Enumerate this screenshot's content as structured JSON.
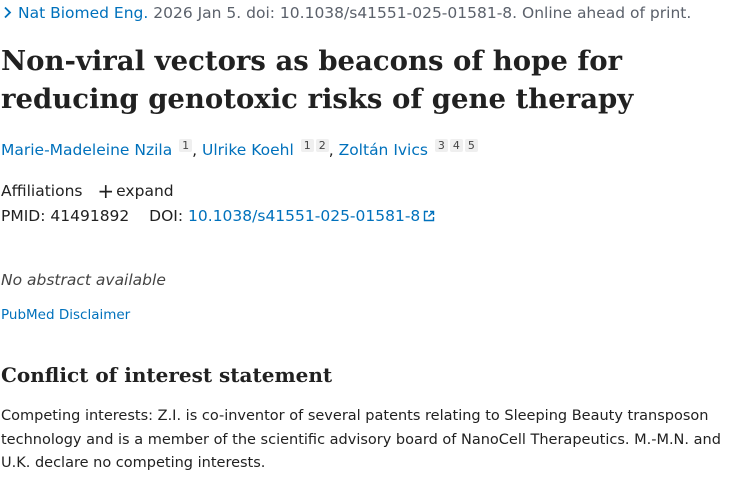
{
  "citation": {
    "journal": "Nat Biomed Eng.",
    "info": " 2026 Jan 5. doi: 10.1038/s41551-025-01581-8. Online ahead of print."
  },
  "title": "Non-viral vectors as beacons of hope for reducing genotoxic risks of gene therapy",
  "authors": [
    {
      "name": "Marie-Madeleine Nzila",
      "sups": [
        "1"
      ]
    },
    {
      "name": "Ulrike Koehl",
      "sups": [
        "1",
        "2"
      ]
    },
    {
      "name": "Zoltán Ivics",
      "sups": [
        "3",
        "4",
        "5"
      ]
    }
  ],
  "affiliations": {
    "label": "Affiliations",
    "expand": "expand"
  },
  "identifiers": {
    "pmid_label": "PMID:",
    "pmid": "41491892",
    "doi_label": "DOI:",
    "doi": "10.1038/s41551-025-01581-8"
  },
  "abstract_text": "No abstract available",
  "disclaimer": "PubMed Disclaimer",
  "coi": {
    "heading": "Conflict of interest statement",
    "text": "Competing interests: Z.I. is co-inventor of several patents relating to Sleeping Beauty transposon technology and is a member of the scientific advisory board of NanoCell Therapeutics. M.-M.N. and U.K. declare no competing interests."
  },
  "colors": {
    "link": "#0071bc",
    "text": "#212121",
    "muted": "#5b616b"
  }
}
